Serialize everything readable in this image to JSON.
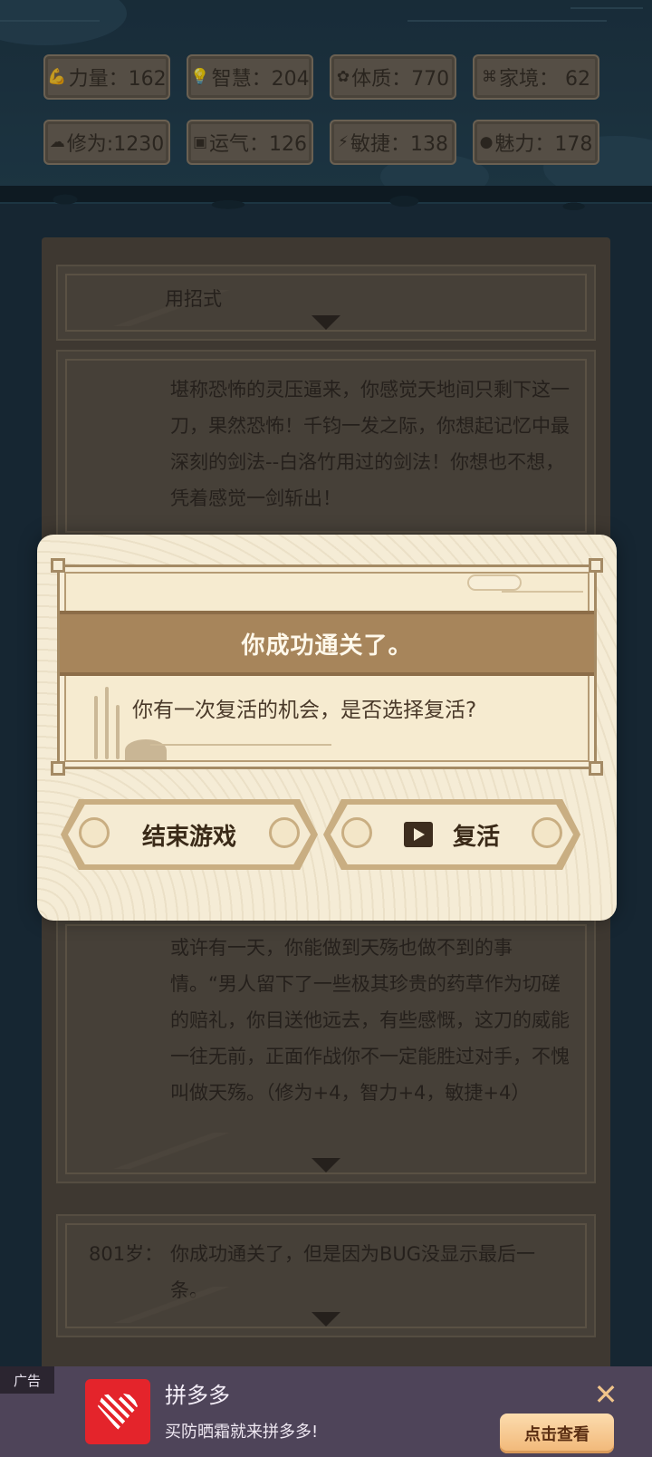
{
  "stats": [
    {
      "icon": "strength-icon",
      "glyph": "💪",
      "label": "力量：162"
    },
    {
      "icon": "wisdom-icon",
      "glyph": "💡",
      "label": "智慧：204"
    },
    {
      "icon": "constitution-icon",
      "glyph": "✿",
      "label": "体质：770"
    },
    {
      "icon": "family-icon",
      "glyph": "⌘",
      "label": "家境： 62"
    },
    {
      "icon": "cultivation-icon",
      "glyph": "☁",
      "label": "修为:1230"
    },
    {
      "icon": "luck-icon",
      "glyph": "▣",
      "label": "运气：126"
    },
    {
      "icon": "agility-icon",
      "glyph": "⚡",
      "label": "敏捷：138"
    },
    {
      "icon": "charm-icon",
      "glyph": "●",
      "label": "魅力：178"
    }
  ],
  "log": {
    "entries": [
      {
        "text": "用招式"
      },
      {
        "text": "堪称恐怖的灵压逼来，你感觉天地间只剩下这一刀，果然恐怖！千钧一发之际，你想起记忆中最深刻的剑法--白洛竹用过的剑法！你想也不想，凭着感觉一剑斩出！"
      },
      {
        "text": "或许有一天，你能做到天殇也做不到的事情。“男人留下了一些极其珍贵的药草作为切磋的赔礼，你目送他远去，有些感慨，这刀的威能一往无前，正面作战你不一定能胜过对手，不愧叫做天殇。（修为+4，智力+4，敏捷+4）"
      },
      {
        "age": "801岁：",
        "text": "你成功通关了，但是因为BUG没显示最后一条。"
      }
    ]
  },
  "modal": {
    "title": "你成功通关了。",
    "message": "你有一次复活的机会，是否选择复活?",
    "end_button": "结束游戏",
    "revive_button": "复活"
  },
  "ad": {
    "tag": "广告",
    "app_name": "拼多多",
    "subtitle": "买防晒霜就来拼多多!",
    "cta": "点击查看",
    "close": "✕",
    "logo_text": "拼"
  }
}
